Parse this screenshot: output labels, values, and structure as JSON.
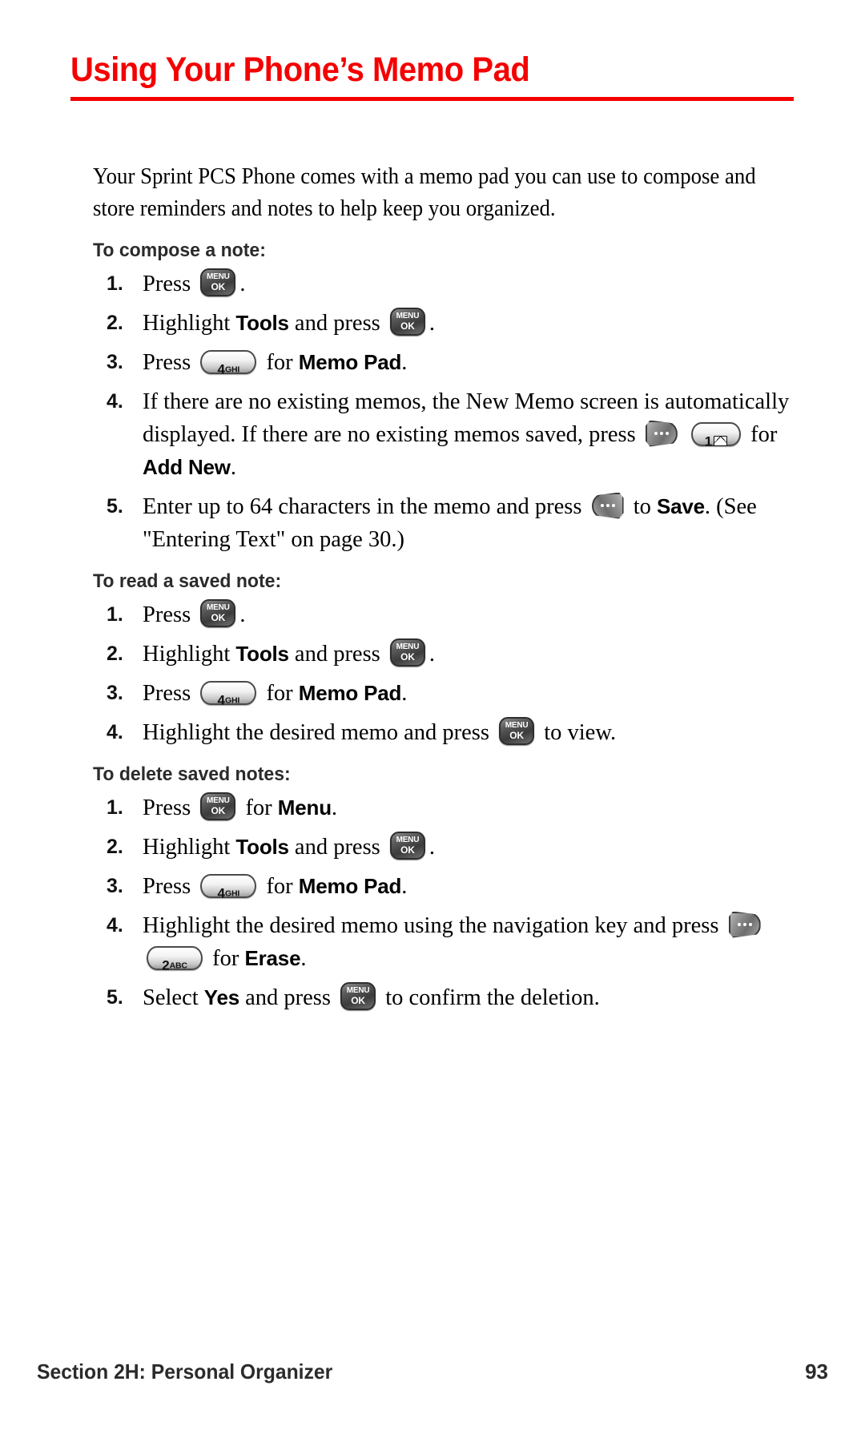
{
  "document": {
    "title": "Using Your Phone’s Memo Pad",
    "title_color": "#f40000",
    "intro": "Your Sprint PCS Phone comes with a memo pad you can use to compose and store reminders and notes to help keep you organized."
  },
  "sections": [
    {
      "heading": "To compose a note:",
      "steps": [
        {
          "num": "1.",
          "parts": [
            "Press ",
            "[key:menuok]",
            "."
          ]
        },
        {
          "num": "2.",
          "parts": [
            "Highlight ",
            "[b:Tools]",
            " and press ",
            "[key:menuok]",
            "."
          ]
        },
        {
          "num": "3.",
          "parts": [
            "Press ",
            "[key:4ghi]",
            " for ",
            "[b:Memo Pad]",
            "."
          ]
        },
        {
          "num": "4.",
          "parts": [
            "If there are no existing memos, the New Memo screen is automatically displayed. If there are no existing memos saved, press ",
            "[key:softleft]",
            " ",
            "[key:1msg]",
            " for ",
            "[b:Add New]",
            "."
          ]
        },
        {
          "num": "5.",
          "parts": [
            "Enter up to 64 characters in the memo and press ",
            "[key:softright]",
            " to ",
            "[b:Save]",
            ". (See \"Entering Text\" on page 30.)"
          ]
        }
      ]
    },
    {
      "heading": "To read a saved note:",
      "steps": [
        {
          "num": "1.",
          "parts": [
            "Press ",
            "[key:menuok]",
            "."
          ]
        },
        {
          "num": "2.",
          "parts": [
            "Highlight ",
            "[b:Tools]",
            " and press ",
            "[key:menuok]",
            "."
          ]
        },
        {
          "num": "3.",
          "parts": [
            "Press ",
            "[key:4ghi]",
            " for ",
            "[b:Memo Pad]",
            "."
          ]
        },
        {
          "num": "4.",
          "parts": [
            "Highlight the desired memo and press ",
            "[key:menuok]",
            " to view."
          ]
        }
      ]
    },
    {
      "heading": "To delete saved notes:",
      "steps": [
        {
          "num": "1.",
          "parts": [
            "Press ",
            "[key:menuok]",
            " for ",
            "[b:Menu]",
            "."
          ]
        },
        {
          "num": "2.",
          "parts": [
            "Highlight ",
            "[b:Tools]",
            " and press ",
            "[key:menuok]",
            "."
          ]
        },
        {
          "num": "3.",
          "parts": [
            "Press ",
            "[key:4ghi]",
            " for ",
            "[b:Memo Pad]",
            "."
          ]
        },
        {
          "num": "4.",
          "parts": [
            "Highlight the desired memo using the navigation key and press ",
            "[key:softleft]",
            " ",
            "[key:2abc]",
            " for ",
            "[b:Erase]",
            "."
          ]
        },
        {
          "num": "5.",
          "parts": [
            "Select ",
            "[b:Yes]",
            " and press ",
            "[key:menuok]",
            " to confirm the deletion."
          ]
        }
      ]
    }
  ],
  "keys": {
    "menuok": {
      "name": "menu-ok-key-icon",
      "line1": "MENU",
      "line2": "OK"
    },
    "4ghi": {
      "name": "number-key-4-ghi-icon",
      "digit": "4",
      "sub": "GHI"
    },
    "2abc": {
      "name": "number-key-2-abc-icon",
      "digit": "2",
      "sub": "ABC"
    },
    "1msg": {
      "name": "number-key-1-message-icon",
      "digit": "1",
      "sub": "envelope"
    },
    "softleft": {
      "name": "left-soft-key-icon",
      "dots": 3
    },
    "softright": {
      "name": "right-soft-key-icon",
      "dots": 3
    }
  },
  "footer": {
    "section": "Section 2H: Personal Organizer",
    "page_number": "93"
  }
}
